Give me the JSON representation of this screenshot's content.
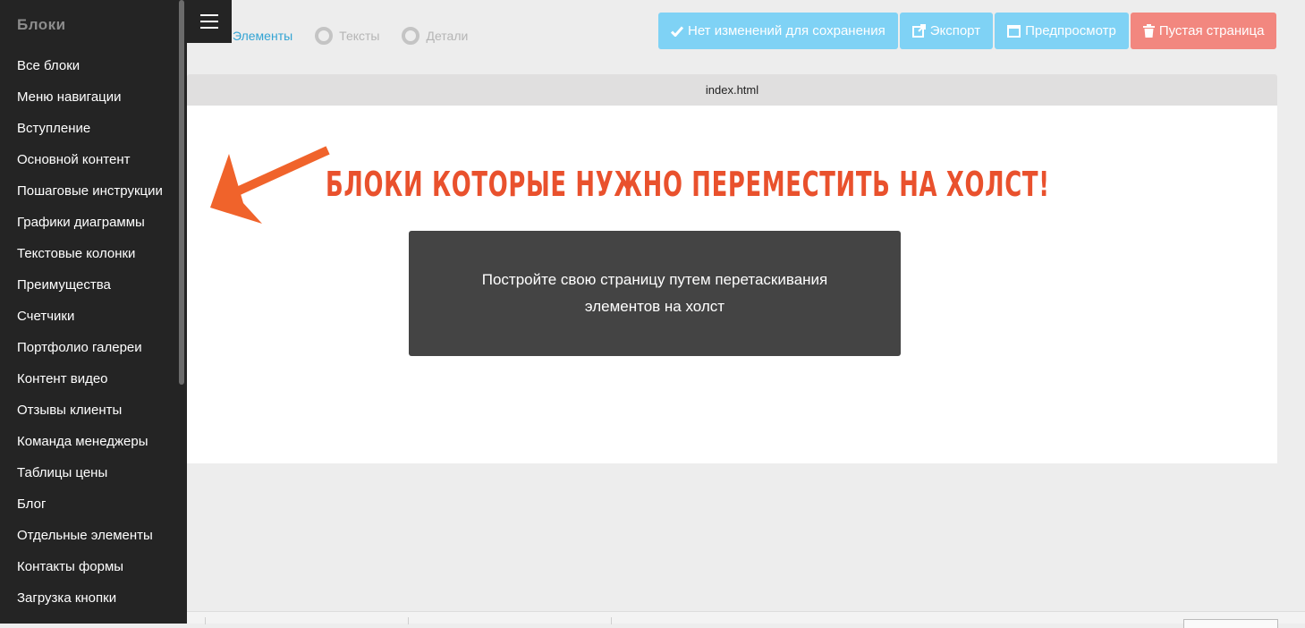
{
  "sidebar": {
    "title": "Блоки",
    "items": [
      {
        "label": "Все блоки"
      },
      {
        "label": "Меню навигации"
      },
      {
        "label": "Вступление"
      },
      {
        "label": "Основной контент"
      },
      {
        "label": "Пошаговые инструкции"
      },
      {
        "label": "Графики диаграммы"
      },
      {
        "label": "Текстовые колонки"
      },
      {
        "label": "Преимущества"
      },
      {
        "label": "Счетчики"
      },
      {
        "label": "Портфолио галереи"
      },
      {
        "label": "Контент видео"
      },
      {
        "label": "Отзывы клиенты"
      },
      {
        "label": "Команда менеджеры"
      },
      {
        "label": "Таблицы цены"
      },
      {
        "label": "Блог"
      },
      {
        "label": "Отдельные элементы"
      },
      {
        "label": "Контакты формы"
      },
      {
        "label": "Загрузка кнопки"
      }
    ]
  },
  "steps": [
    {
      "label": "Элементы",
      "active": true
    },
    {
      "label": "Тексты",
      "active": false
    },
    {
      "label": "Детали",
      "active": false
    }
  ],
  "toolbar": {
    "save_label": "Нет изменений для сохранения",
    "export_label": "Экспорт",
    "preview_label": "Предпросмотр",
    "empty_label": "Пустая страница"
  },
  "canvas": {
    "filename": "index.html",
    "headline": "БЛОКИ КОТОРЫЕ НУЖНО ПЕРЕМЕСТИТЬ НА ХОЛСТ!",
    "drop_line1": "Постройте свою страницу путем перетаскивания",
    "drop_line2": "элементов на холст"
  },
  "colors": {
    "accent": "#33a4d4",
    "info_button": "#7fd2f5",
    "danger_button": "#f2877f",
    "headline": "#e9512d",
    "sidebar_bg": "#242424"
  },
  "icons": {
    "menu": "hamburger-icon",
    "save": "check-icon",
    "export": "external-link-icon",
    "preview": "window-icon",
    "empty": "trash-icon",
    "pointer": "arrow-icon"
  }
}
